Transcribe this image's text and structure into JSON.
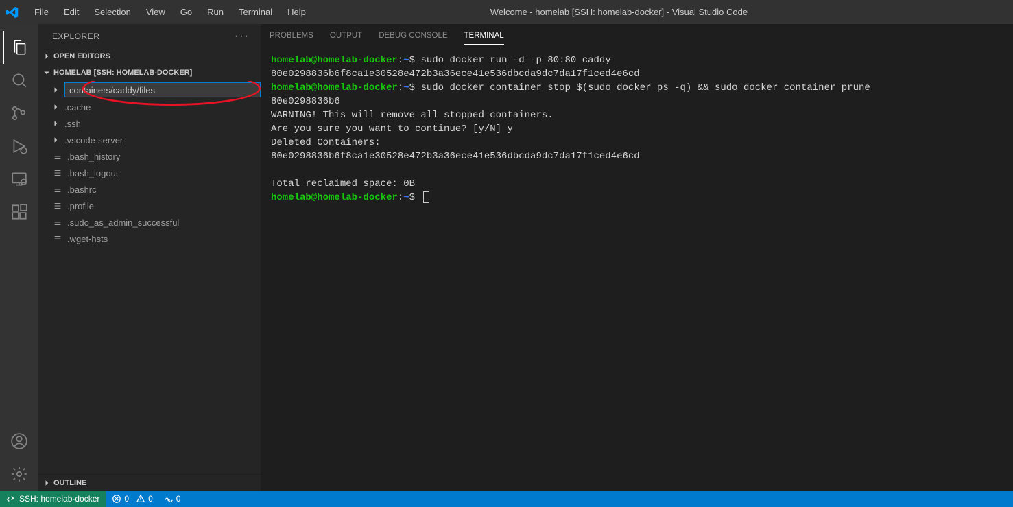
{
  "window_title": "Welcome - homelab [SSH: homelab-docker] - Visual Studio Code",
  "menu": [
    "File",
    "Edit",
    "Selection",
    "View",
    "Go",
    "Run",
    "Terminal",
    "Help"
  ],
  "explorer": {
    "title": "EXPLORER",
    "open_editors_label": "OPEN EDITORS",
    "workspace_label": "HOMELAB [SSH: HOMELAB-DOCKER]",
    "new_folder_input": "containers/caddy/files",
    "folders": [
      ".cache",
      ".ssh",
      ".vscode-server"
    ],
    "files": [
      ".bash_history",
      ".bash_logout",
      ".bashrc",
      ".profile",
      ".sudo_as_admin_successful",
      ".wget-hsts"
    ],
    "outline_label": "OUTLINE"
  },
  "panel_tabs": {
    "problems": "PROBLEMS",
    "output": "OUTPUT",
    "debug_console": "DEBUG CONSOLE",
    "terminal": "TERMINAL"
  },
  "terminal": {
    "prompt_user": "homelab@homelab-docker",
    "prompt_path": "~",
    "cmd1": "sudo docker run -d -p 80:80 caddy",
    "out1": "80e0298836b6f8ca1e30528e472b3a36ece41e536dbcda9dc7da17f1ced4e6cd",
    "cmd2": "sudo docker container stop $(sudo docker ps -q) && sudo docker container prune",
    "out2_l1": "80e0298836b6",
    "out2_l2": "WARNING! This will remove all stopped containers.",
    "out2_l3": "Are you sure you want to continue? [y/N] y",
    "out2_l4": "Deleted Containers:",
    "out2_l5": "80e0298836b6f8ca1e30528e472b3a36ece41e536dbcda9dc7da17f1ced4e6cd",
    "out2_blank": "",
    "out2_l6": "Total reclaimed space: 0B"
  },
  "statusbar": {
    "remote_label": "SSH: homelab-docker",
    "errors": "0",
    "warnings": "0",
    "ports": "0"
  }
}
